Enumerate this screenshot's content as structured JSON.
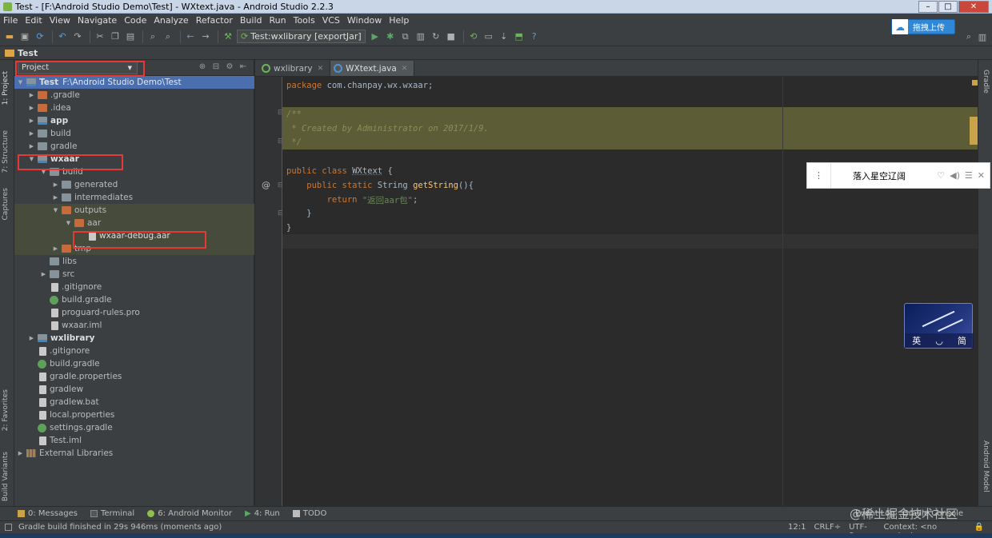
{
  "window": {
    "title": "Test - [F:\\Android Studio Demo\\Test] - WXtext.java - Android Studio 2.2.3",
    "controls": {
      "minimize": "–",
      "maximize": "□",
      "close": "✕"
    }
  },
  "menu": [
    "File",
    "Edit",
    "View",
    "Navigate",
    "Code",
    "Analyze",
    "Refactor",
    "Build",
    "Run",
    "Tools",
    "VCS",
    "Window",
    "Help"
  ],
  "toolbar": {
    "run_config": "Test:wxlibrary [exportJar]",
    "upload_label": "拖拽上传"
  },
  "navbar": {
    "project": "Test"
  },
  "left_strip": {
    "project": "1: Project",
    "structure": "7: Structure",
    "captures": "Captures",
    "favorites": "2: Favorites",
    "build_variants": "Build Variants"
  },
  "right_strip": {
    "gradle": "Gradle",
    "android_model": "Android Model"
  },
  "project_panel": {
    "view_selector": "Project",
    "tree": [
      {
        "label": "Test",
        "path": "F:\\Android Studio Demo\\Test"
      },
      {
        "label": ".gradle"
      },
      {
        "label": ".idea"
      },
      {
        "label": "app"
      },
      {
        "label": "build"
      },
      {
        "label": "gradle"
      },
      {
        "label": "wxaar"
      },
      {
        "label": "build"
      },
      {
        "label": "generated"
      },
      {
        "label": "intermediates"
      },
      {
        "label": "outputs"
      },
      {
        "label": "aar"
      },
      {
        "label": "wxaar-debug.aar"
      },
      {
        "label": "tmp"
      },
      {
        "label": "libs"
      },
      {
        "label": "src"
      },
      {
        "label": ".gitignore"
      },
      {
        "label": "build.gradle"
      },
      {
        "label": "proguard-rules.pro"
      },
      {
        "label": "wxaar.iml"
      },
      {
        "label": "wxlibrary"
      },
      {
        "label": ".gitignore"
      },
      {
        "label": "build.gradle"
      },
      {
        "label": "gradle.properties"
      },
      {
        "label": "gradlew"
      },
      {
        "label": "gradlew.bat"
      },
      {
        "label": "local.properties"
      },
      {
        "label": "settings.gradle"
      },
      {
        "label": "Test.iml"
      },
      {
        "label": "External Libraries"
      }
    ]
  },
  "editor": {
    "tabs": [
      "wxlibrary",
      "WXtext.java"
    ],
    "code": {
      "l1_kw": "package ",
      "l1_rest": "com.chanpay.wx.wxaar;",
      "l3": "/**",
      "l4": " * Created by Administrator on 2017/1/9.",
      "l5": " */",
      "l7_kw": "public class ",
      "l7_cls": "WXtext",
      "l7_rest": " {",
      "l8_kw": "    public static ",
      "l8_type": "String ",
      "l8_mth": "getString",
      "l8_rest": "(){",
      "l9_kw": "        return ",
      "l9_str": "\"返回aar包\"",
      "l9_rest": ";",
      "l10": "    }",
      "l11": "}"
    }
  },
  "music_widget": {
    "song": "落入星空辽阔"
  },
  "ime_widget": {
    "left": "英",
    "mid": "◡",
    "right": "简"
  },
  "bottom_tabs": {
    "messages": "0: Messages",
    "terminal": "Terminal",
    "monitor": "6: Android Monitor",
    "run": "4: Run",
    "todo": "TODO",
    "event_log": "Event Log",
    "gradle_console": "Gradle Console"
  },
  "status": {
    "message": "Gradle build finished in 29s 946ms (moments ago)",
    "position": "12:1",
    "line_sep": "CRLF÷",
    "encoding": "UTF-8÷",
    "context": "Context: <no context>"
  },
  "watermark": "@稀土掘金技术社区"
}
